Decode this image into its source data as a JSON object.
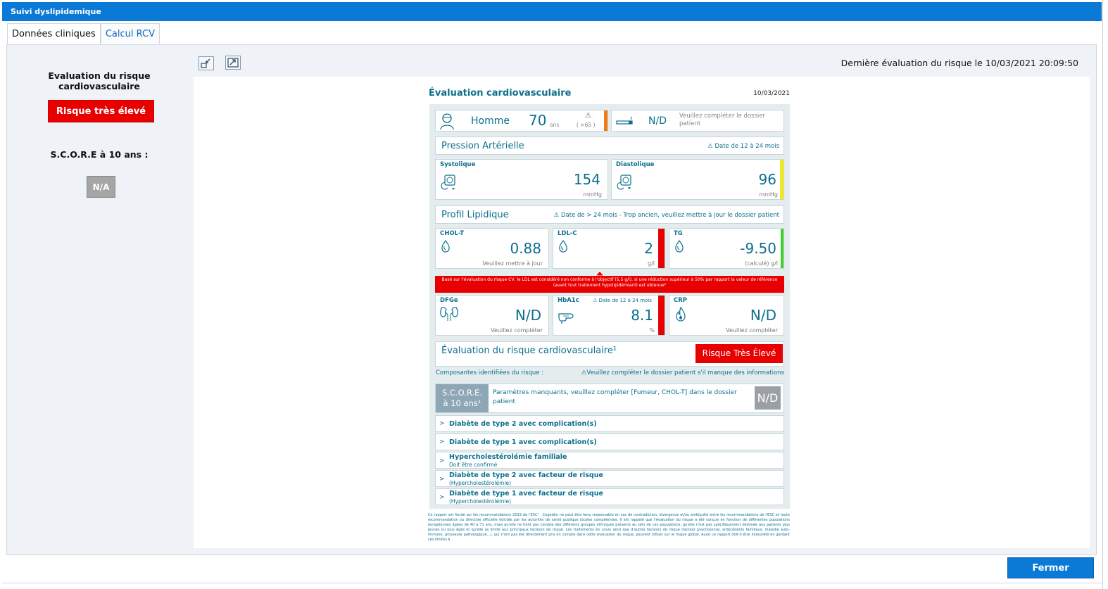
{
  "window": {
    "title": "Suivi dyslipidemique"
  },
  "tabs": [
    {
      "label": "Données cliniques",
      "active": true
    },
    {
      "label": "Calcul RCV",
      "active": false
    }
  ],
  "left": {
    "title": "Evaluation du risque cardiovasculaire",
    "risk_label": "Risque très élevé",
    "score_title": "S.C.O.R.E à 10 ans :",
    "score_value": "N/A"
  },
  "toolbar": {
    "last_eval_label": "Dernière évaluation du risque le",
    "last_eval_date": "10/03/2021 20:09:50"
  },
  "report": {
    "title": "Évaluation cardiovasculaire",
    "date": "10/03/2021",
    "patient": {
      "sex": "Homme",
      "age": "70",
      "age_unit": "ans",
      "age_note": "( >65 )"
    },
    "smoking": {
      "value": "N/D",
      "note": "Veuillez compléter le dossier patient"
    },
    "pa": {
      "title": "Pression Artérielle",
      "warning": "Date de 12 à 24 mois"
    },
    "systolique": {
      "label": "Systolique",
      "value": "154",
      "unit": "mmHg"
    },
    "diastolique": {
      "label": "Diastolique",
      "value": "96",
      "unit": "mmHg"
    },
    "lipid": {
      "title": "Profil Lipidique",
      "warning": "Date de > 24 mois - Trop ancien, veuillez mettre à jour le dossier patient"
    },
    "cholt": {
      "label": "CHOL-T",
      "value": "0.88",
      "unit": "Veuillez mettre à jour"
    },
    "ldlc": {
      "label": "LDL-C",
      "value": "2",
      "unit": "g/l"
    },
    "tg": {
      "label": "TG",
      "value": "-9.50",
      "unit": "(calculé) g/l"
    },
    "ldl_alert": "Basé sur l'évaluation du risque CV, le LDL est considéré non conforme à l'objectif (5,5 g/l), si une réduction supérieur à 50% par rapport la valeur de référence (avant tout traitement hypolipidémiant) est obtenue²",
    "dfge": {
      "label": "DFGe",
      "value": "N/D",
      "unit": "Veuillez compléter"
    },
    "hba1c": {
      "label": "HbA1c",
      "warning": "Date de 12 à 24 mois",
      "value": "8.1",
      "unit": "%"
    },
    "crp": {
      "label": "CRP",
      "value": "N/D",
      "unit": "Veuillez compléter"
    },
    "risk_eval": {
      "title": "Évaluation du risque cardiovasculaire¹",
      "badge": "Risque Très Élevé"
    },
    "components": {
      "label": "Composantes identifiées du risque :",
      "warning": "Veuillez compléter le dossier patient s'il manque des informations"
    },
    "score": {
      "label1": "S.C.O.R.E.",
      "label2": "à 10 ans¹",
      "text": "Paramètres manquants, veuillez compléter [Fumeur, CHOL-T] dans le dossier patient",
      "value": "N/D"
    },
    "categories": [
      {
        "title": "Diabète de type 2 avec complication(s)",
        "sub": ""
      },
      {
        "title": "Diabète de type 1 avec complication(s)",
        "sub": ""
      },
      {
        "title": "Hypercholestérolémie familiale",
        "sub": "Doit être confirmé"
      },
      {
        "title": "Diabète de type 2 avec facteur de risque",
        "sub": "(Hypercholestérolémie)"
      },
      {
        "title": "Diabète de type 1 avec facteur de risque",
        "sub": "(Hypercholestérolémie)"
      }
    ],
    "chevron": ">",
    "fineprint": "Ce rapport est fondé sur les recommandations 2019 de l'ESC¹ . Cegedim ne peut être tenu responsable en cas de contradiction, divergence et/ou ambiguïté entre les recommandations de l'ESC et toute recommandation ou directive officielle édictée par les autorités de santé publique locales compétentes. Il est rappelé que l'évaluation du risque a été conçue en fonction de différentes populations européennes âgées de 40 à 71 ans, mais qu'elle ne tient pas compte des différents groupes ethniques présents au sein de ces populations, qu'elle n'est pas spécifiquement destinée aux patients plus jeunes ou plus âgés et qu'elle se limite aux principaux facteurs de risque. Les traitements en cours ainsi que d'autres facteurs de risque (facteur psychosocial, antécédents familiaux, maladie auto-immune, grossesse pathologique...), qui n'ont pas été directement pris en compte dans cette évaluation du risque, peuvent influer sur le risque global. Aussi ce rapport doit-il être interprété en gardant ces limites à"
  },
  "footer": {
    "close_label": "Fermer"
  },
  "colors": {
    "accent": "#0b7ad6",
    "teal": "#0c6f8e",
    "danger": "#e80000",
    "warning_orange": "#f07d12",
    "warning_yellow": "#f2ea12",
    "ok_green": "#3ed12a"
  }
}
